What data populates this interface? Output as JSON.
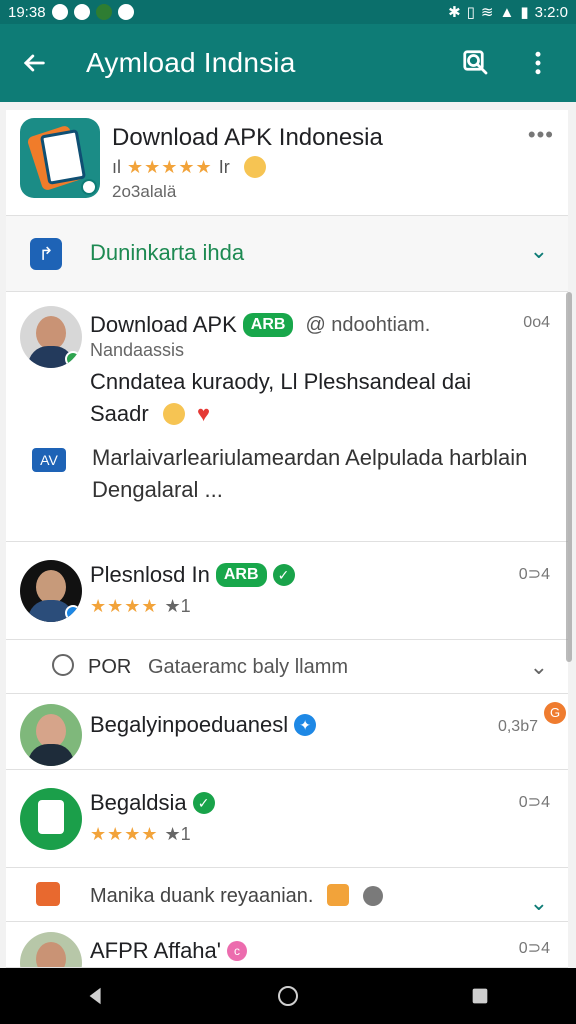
{
  "status_bar": {
    "time_left": "19:38",
    "time_right": "3:2:0",
    "icons": [
      "notification-icon",
      "notification-icon",
      "notification-icon",
      "bluetooth-icon",
      "vibrate-icon",
      "wifi-icon",
      "signal-icon",
      "battery-icon"
    ]
  },
  "appbar": {
    "title": "Aymload Indnsia",
    "back_icon": "back-arrow-icon",
    "search_icon": "search-icon",
    "more_icon": "more-vert-icon"
  },
  "app_card": {
    "title": "Download APK Indonesia",
    "rating_text": "ıl",
    "rating_stars": "★★★★★",
    "rating_extra": "Ir",
    "sub": "2o3alalä"
  },
  "section": {
    "label": "Duninkarta ihda",
    "icon": "pin-icon"
  },
  "post": {
    "name": "Download APK",
    "badge": "ARB",
    "handle": "@ ndoohtiam.",
    "sub": "Nandaassis",
    "time": "0o4",
    "body": "Cnndatea kuraody, Ll Pleshsandeal dai Saadr",
    "link_text": "Marlaivarleariulameardan Aelpulada harblain Dengalaral ...",
    "link_icon_text": "AV"
  },
  "items": [
    {
      "name": "Plesnlosd In",
      "badge": "ARB",
      "rating_stars": "★★★★",
      "rating_extra": "★1",
      "time": "0⊃4"
    },
    {
      "name": "Begalyinpoeduanesl",
      "time": "0,3b7"
    },
    {
      "name": "Begaldsia",
      "rating_stars": "★★★★",
      "rating_extra": "★1",
      "time": "0⊃4"
    },
    {
      "name": "AFPR Affaha'",
      "time": "0⊃4"
    }
  ],
  "filter": {
    "left": "POR",
    "text": "Gataeramc baly llamm"
  },
  "manika": {
    "text": "Manika duank reyaanian."
  },
  "colors": {
    "appbar": "#0e7c76",
    "status": "#0b6f6b",
    "green_pill": "#18a74b"
  }
}
